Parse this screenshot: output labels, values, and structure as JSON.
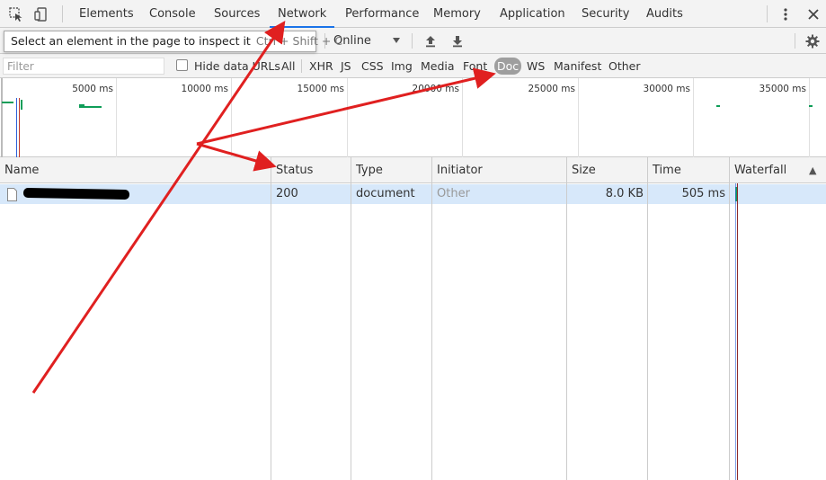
{
  "tabs": [
    {
      "label": "Elements",
      "active": false
    },
    {
      "label": "Console",
      "active": false
    },
    {
      "label": "Sources",
      "active": false
    },
    {
      "label": "Network",
      "active": true
    },
    {
      "label": "Performance",
      "active": false
    },
    {
      "label": "Memory",
      "active": false
    },
    {
      "label": "Application",
      "active": false
    },
    {
      "label": "Security",
      "active": false
    },
    {
      "label": "Audits",
      "active": false
    }
  ],
  "tooltip": {
    "text": "Select an element in the page to inspect it",
    "shortcut": "Ctrl + Shift + C"
  },
  "throttling": {
    "value": "Online"
  },
  "filter": {
    "placeholder": "Filter",
    "hide_data_urls_label": "Hide data URLs",
    "hide_data_urls_checked": false
  },
  "resource_types": [
    {
      "label": "All",
      "selected": false
    },
    {
      "label": "XHR",
      "selected": false
    },
    {
      "label": "JS",
      "selected": false
    },
    {
      "label": "CSS",
      "selected": false
    },
    {
      "label": "Img",
      "selected": false
    },
    {
      "label": "Media",
      "selected": false
    },
    {
      "label": "Font",
      "selected": false
    },
    {
      "label": "Doc",
      "selected": true
    },
    {
      "label": "WS",
      "selected": false
    },
    {
      "label": "Manifest",
      "selected": false
    },
    {
      "label": "Other",
      "selected": false
    }
  ],
  "overview": {
    "ticks": [
      "5000 ms",
      "10000 ms",
      "15000 ms",
      "20000 ms",
      "25000 ms",
      "30000 ms",
      "35000 ms"
    ]
  },
  "table": {
    "columns": [
      "Name",
      "Status",
      "Type",
      "Initiator",
      "Size",
      "Time",
      "Waterfall"
    ],
    "sort_indicator": "▲",
    "rows": [
      {
        "name": "",
        "name_redacted": true,
        "status": "200",
        "type": "document",
        "initiator": "Other",
        "size": "8.0 KB",
        "time": "505 ms"
      }
    ]
  },
  "colors": {
    "accent": "#1a73e8",
    "annotation_arrow": "#e02020",
    "selected_row": "#d7e8fa",
    "waterfall_bar": "#0f9d58"
  }
}
